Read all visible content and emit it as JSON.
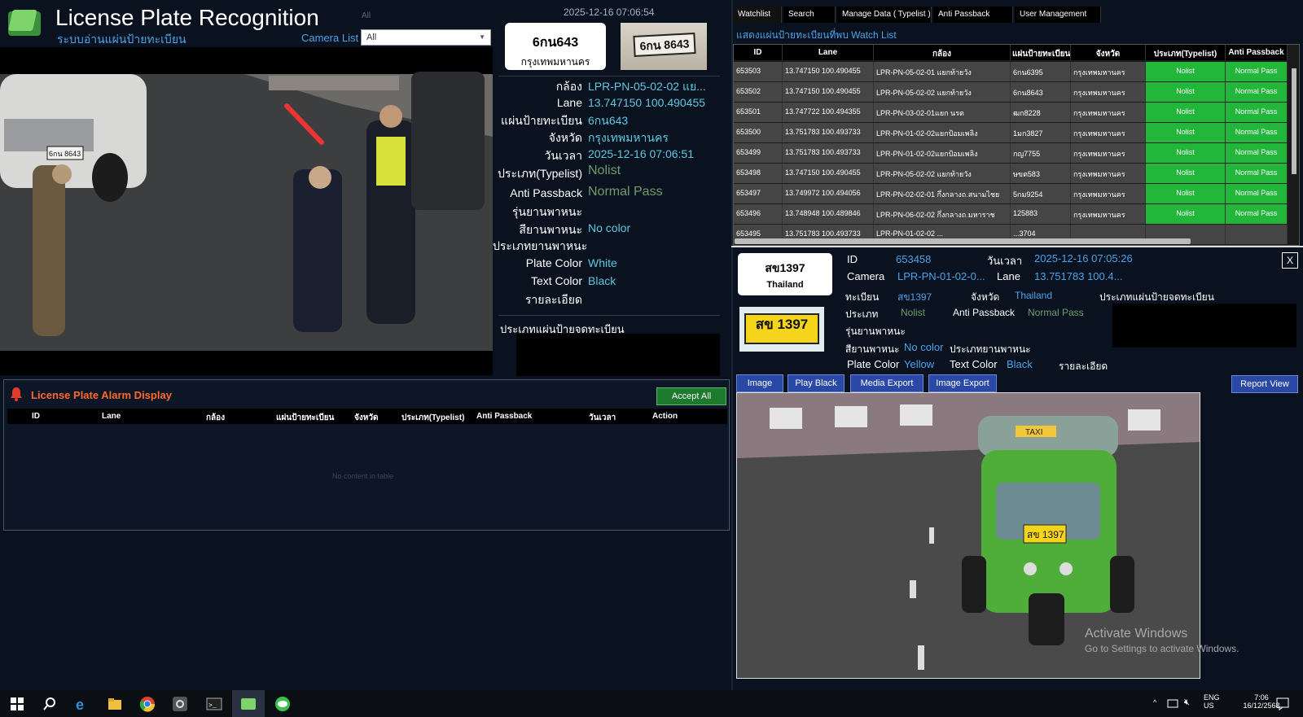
{
  "header": {
    "title": "License Plate Recognition",
    "subtitle": "ระบบอ่านแผ่นป้ายทะเบียน",
    "camera_list_faint": "All",
    "camera_list_label": "Camera List",
    "camera_list_value": "All",
    "timestamp": "2025-12-16 07:06:54"
  },
  "current_plate": {
    "number": "6กน643",
    "province": "กรุงเทพมหานคร",
    "crop_text": "6กน 8643"
  },
  "scene_plate_text": "6กน 8643",
  "info": {
    "rows": [
      {
        "label": "กล้อง",
        "value": "LPR-PN-05-02-02 แย..."
      },
      {
        "label": "Lane",
        "value": "13.747150 100.490455"
      },
      {
        "label": "แผ่นป้ายทะเบียน",
        "value": "6กน643"
      },
      {
        "label": "จังหวัด",
        "value": "กรุงเทพมหานคร"
      },
      {
        "label": "วันเวลา",
        "value": "2025-12-16 07:06:51"
      },
      {
        "label": "ประเภท(Typelist)",
        "value": "Nolist"
      },
      {
        "label": "Anti Passback",
        "value": "Normal Pass"
      },
      {
        "label": "รุ่นยานพาหนะ",
        "value": ""
      },
      {
        "label": "สียานพาหนะ",
        "value": "No color"
      },
      {
        "label": "ประเภทยานพาหนะ",
        "value": ""
      },
      {
        "label": "Plate Color",
        "value": "White"
      },
      {
        "label": "Text Color",
        "value": "Black"
      },
      {
        "label": "รายละเอียด",
        "value": ""
      }
    ],
    "plate_type_label": "ประเภทแผ่นป้ายจดทะเบียน"
  },
  "alarm": {
    "title": "License Plate Alarm Display",
    "accept_all": "Accept All",
    "columns": [
      "ID",
      "Lane",
      "กล้อง",
      "แผ่นป้ายทะเบียน",
      "จังหวัด",
      "ประเภท(Typelist)",
      "Anti Passback",
      "วันเวลา",
      "Action"
    ],
    "empty_text": "No content in table"
  },
  "watchlist": {
    "tabs": [
      "Watchlist",
      "Search",
      "Manage Data ( Typelist )",
      "Anti Passback",
      "User Management"
    ],
    "title": "แสดงแผ่นป้ายทะเบียนที่พบ Watch List",
    "columns": [
      "ID",
      "Lane",
      "กล้อง",
      "แผ่นป้ายทะเบียน",
      "จังหวัด",
      "ประเภท(Typelist)",
      "Anti Passback"
    ],
    "rows": [
      [
        "653503",
        "13.747150 100.490455",
        "LPR-PN-05-02-01 แยกท้ายวัง",
        "6กน6395",
        "กรุงเทพมหานคร",
        "Nolist",
        "Normal Pass"
      ],
      [
        "653502",
        "13.747150 100.490455",
        "LPR-PN-05-02-02 แยกท้ายวัง",
        "6กน8643",
        "กรุงเทพมหานคร",
        "Nolist",
        "Normal Pass"
      ],
      [
        "653501",
        "13.747722 100.494355",
        "LPR-PN-03-02-01แยก นรต",
        "ฒก8228",
        "กรุงเทพมหานคร",
        "Nolist",
        "Normal Pass"
      ],
      [
        "653500",
        "13.751783 100.493733",
        "LPR-PN-01-02-02แยกป้อมเพลิง",
        "1มก3827",
        "กรุงเทพมหานคร",
        "Nolist",
        "Normal Pass"
      ],
      [
        "653499",
        "13.751783 100.493733",
        "LPR-PN-01-02-02แยกป้อมเพลิง",
        "กญ7755",
        "กรุงเทพมหานคร",
        "Nolist",
        "Normal Pass"
      ],
      [
        "653498",
        "13.747150 100.490455",
        "LPR-PN-05-02-02 แยกท้ายวัง",
        "ษขต583",
        "กรุงเทพมหานคร",
        "Nolist",
        "Normal Pass"
      ],
      [
        "653497",
        "13.749972 100.494056",
        "LPR-PN-02-02-01 กึ่งกลางถ.สนามไชย",
        "5กม9254",
        "กรุงเทพมหานคร",
        "Nolist",
        "Normal Pass"
      ],
      [
        "653496",
        "13.748948 100.489846",
        "LPR-PN-06-02-02 กึ่งกลางถ.มหาราช",
        "125883",
        "กรุงเทพมหานคร",
        "Nolist",
        "Normal Pass"
      ],
      [
        "653495",
        "13.751783 100.493733",
        "LPR-PN-01-02-02 ...",
        "...3704",
        "",
        "",
        ""
      ]
    ]
  },
  "detail": {
    "plate_number": "สข1397",
    "plate_country": "Thailand",
    "crop_text": "สข 1397",
    "id_label": "ID",
    "id_value": "653458",
    "datetime_label": "วันเวลา",
    "datetime_value": "2025-12-16 07:05:26",
    "camera_label": "Camera",
    "camera_value": "LPR-PN-01-02-0...",
    "lane_label": "Lane",
    "lane_value": "13.751783 100.4...",
    "plate_label": "ทะเบียน",
    "plate_value": "สข1397",
    "province_label": "จังหวัด",
    "province_value": "Thailand",
    "plate_type_label": "ประเภทแผ่นป้ายจดทะเบียน",
    "type_label": "ประเภท",
    "type_value": "Nolist",
    "anti_label": "Anti Passback",
    "anti_value": "Normal Pass",
    "model_label": "รุ่นยานพาหนะ",
    "color_label": "สียานพาหนะ",
    "color_value": "No color",
    "vehicle_type_label": "ประเภทยานพาหนะ",
    "plate_color_label": "Plate Color",
    "plate_color_value": "Yellow",
    "text_color_label": "Text Color",
    "text_color_value": "Black",
    "detail_label": "รายละเอียด",
    "close": "X",
    "buttons": {
      "image": "Image",
      "play_black": "Play Black",
      "media_export": "Media Export",
      "image_export": "Image Export",
      "report_view": "Report View"
    },
    "vehicle_sign": "TAXI",
    "vehicle_plate": "สข 1397"
  },
  "os": {
    "watermark_title": "Activate Windows",
    "watermark_sub": "Go to Settings to activate Windows.",
    "lang_1": "ENG",
    "lang_2": "US",
    "time": "7:06",
    "date": "16/12/2568"
  },
  "colors": {
    "accent_blue": "#4aa3e8",
    "value_cyan": "#5ec8e0",
    "status_green": "#22b63a",
    "alarm_orange": "#ff6a2a"
  }
}
